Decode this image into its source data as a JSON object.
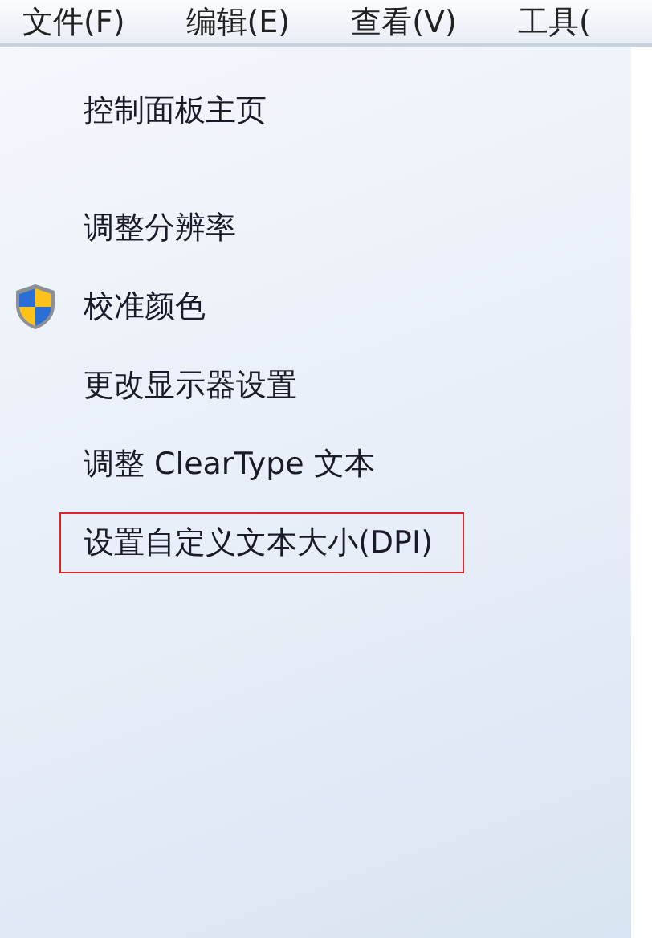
{
  "menu_bar": [
    "文件(F)",
    "编辑(E)",
    "查看(V)",
    "工具("
  ],
  "home_link": "控制面板主页",
  "tasks": [
    {
      "label": "调整分辨率",
      "shield": false,
      "highlighted": false
    },
    {
      "label": "校准颜色",
      "shield": true,
      "highlighted": false
    },
    {
      "label": "更改显示器设置",
      "shield": false,
      "highlighted": false
    },
    {
      "label": "调整 ClearType 文本",
      "shield": false,
      "highlighted": false
    },
    {
      "label": "设置自定义文本大小(DPI)",
      "shield": false,
      "highlighted": true
    }
  ]
}
